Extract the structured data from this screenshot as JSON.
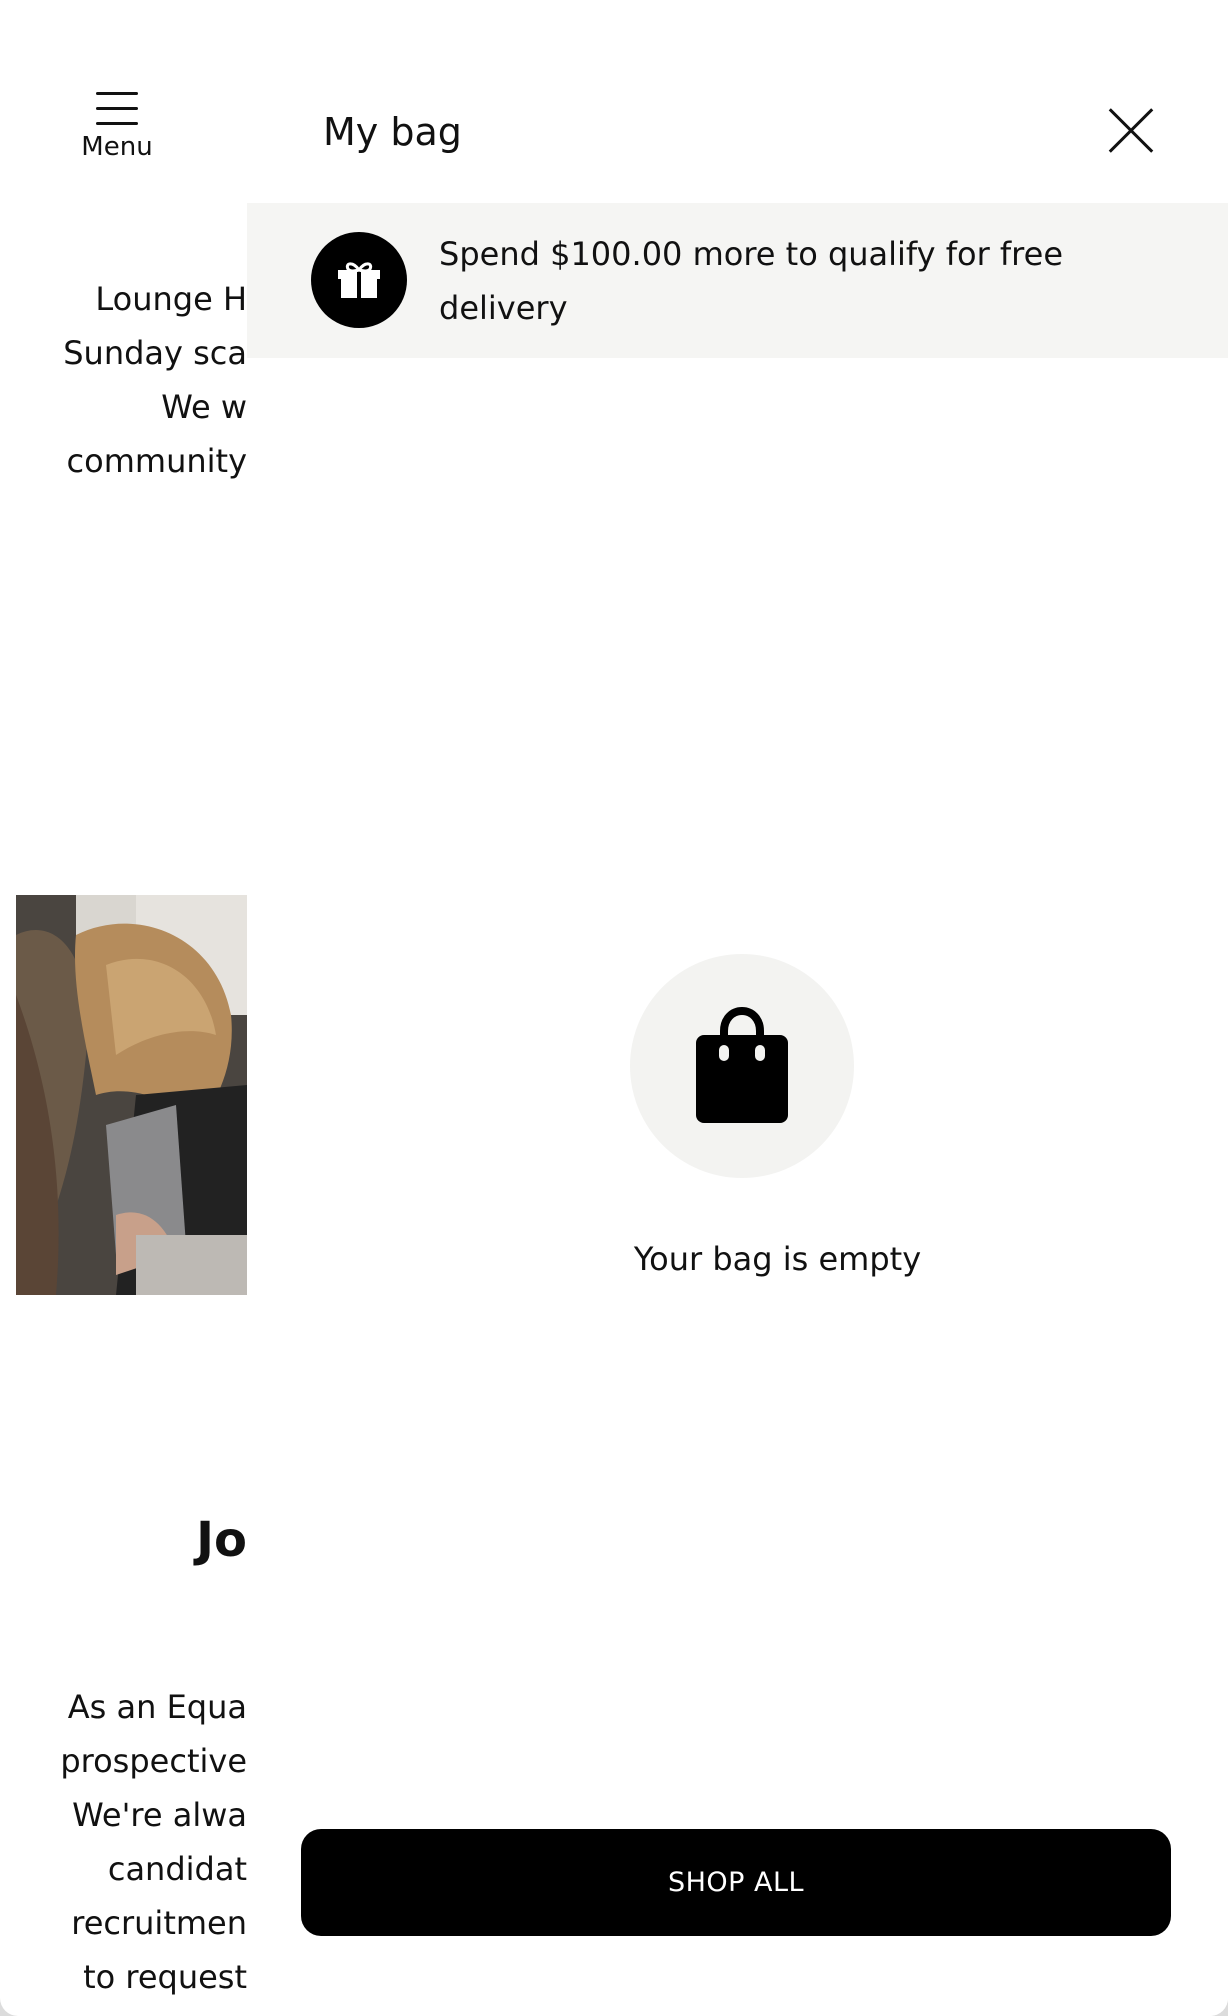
{
  "background_page": {
    "menu_label": "Menu",
    "intro_lines": [
      "Lounge H",
      "Sunday sca",
      "We w",
      "community"
    ],
    "heading": "Jo",
    "body_lines": [
      "As an Equa",
      "prospective",
      "We're alwa",
      "candidat",
      "recruitmen",
      "to request"
    ]
  },
  "drawer": {
    "title": "My bag",
    "promo_text": "Spend $100.00 more to qualify for free delivery",
    "empty_text": "Your bag is empty",
    "shop_all_label": "SHOP ALL"
  },
  "icons": {
    "menu": "hamburger-icon",
    "close": "close-icon",
    "gift": "gift-icon",
    "bag": "shopping-bag-icon"
  },
  "colors": {
    "button_bg": "#000000",
    "button_text": "#ffffff",
    "promo_bg": "#f5f5f3",
    "icon_circle_bg": "#f3f3f1"
  }
}
